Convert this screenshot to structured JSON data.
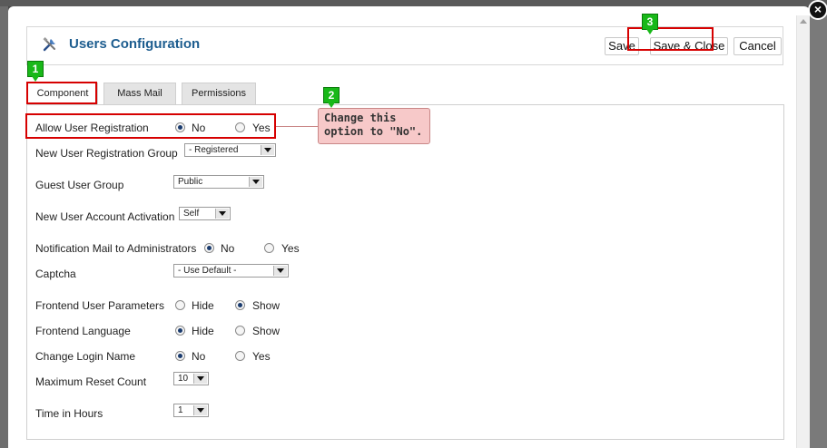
{
  "window": {
    "close_symbol": "×"
  },
  "toolbar": {
    "title": "Users Configuration",
    "icon": "tools-icon",
    "save_label": "Save",
    "save_close_label": "Save & Close",
    "cancel_label": "Cancel"
  },
  "tabs": [
    {
      "label": "Component",
      "active": true
    },
    {
      "label": "Mass Mail",
      "active": false
    },
    {
      "label": "Permissions",
      "active": false
    }
  ],
  "fields": {
    "allow_registration": {
      "label": "Allow User Registration",
      "opt1": "No",
      "opt2": "Yes",
      "selected": "No"
    },
    "new_user_group": {
      "label": "New User Registration Group",
      "value": "- Registered"
    },
    "guest_group": {
      "label": "Guest User Group",
      "value": "Public"
    },
    "account_activation": {
      "label": "New User Account Activation",
      "value": "Self"
    },
    "notification_mail": {
      "label": "Notification Mail to Administrators",
      "opt1": "No",
      "opt2": "Yes",
      "selected": "No"
    },
    "captcha": {
      "label": "Captcha",
      "value": "- Use Default -"
    },
    "frontend_params": {
      "label": "Frontend User Parameters",
      "opt1": "Hide",
      "opt2": "Show",
      "selected": "Show"
    },
    "frontend_language": {
      "label": "Frontend Language",
      "opt1": "Hide",
      "opt2": "Show",
      "selected": "Hide"
    },
    "change_login": {
      "label": "Change Login Name",
      "opt1": "No",
      "opt2": "Yes",
      "selected": "No"
    },
    "max_reset": {
      "label": "Maximum Reset Count",
      "value": "10"
    },
    "time_hours": {
      "label": "Time in Hours",
      "value": "1"
    }
  },
  "annotations": {
    "badge1": "1",
    "badge2": "2",
    "badge3": "3",
    "callout_line1": "Change this",
    "callout_line2": "option to \"No\".",
    "highlight_color": "#d60000",
    "badge_color": "#18b818"
  }
}
